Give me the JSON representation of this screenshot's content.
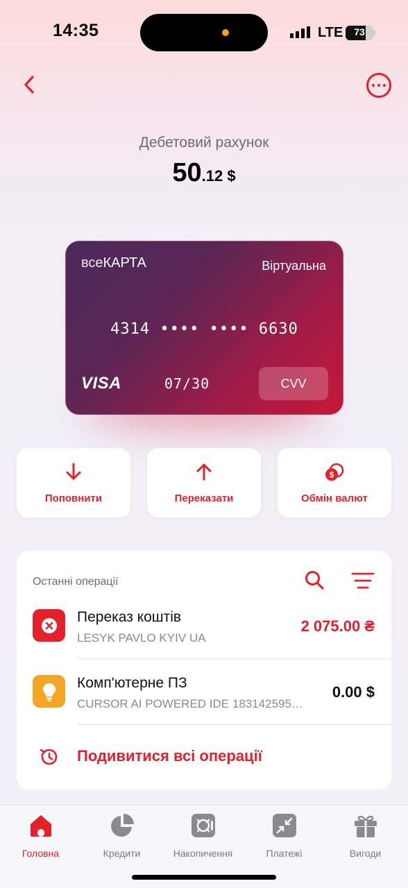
{
  "status_bar": {
    "time": "14:35",
    "network": "LTE",
    "battery": "73"
  },
  "header": {
    "back_icon": "chevron-left-icon",
    "more_icon": "more-dots-icon"
  },
  "account": {
    "title": "Дебетовий рахунок",
    "balance_int": "50",
    "balance_frac": ".12 $"
  },
  "card": {
    "brand_prefix": "все",
    "brand_name": "КАРТА",
    "type": "Віртуальна",
    "number": "4314 •••• •••• 6630",
    "network": "VISA",
    "expiry": "07/30",
    "cvv_label": "CVV"
  },
  "actions": [
    {
      "label": "Поповнити",
      "icon": "arrow-down-icon"
    },
    {
      "label": "Переказати",
      "icon": "arrow-up-icon"
    },
    {
      "label": "Обмін валют",
      "icon": "currency-exchange-icon"
    }
  ],
  "operations": {
    "title": "Останні операції",
    "items": [
      {
        "name": "Переказ коштів",
        "description": "LESYK PAVLO KYIV UA",
        "amount": "2 075.00 ₴",
        "amount_color": "#e4202a",
        "icon": "cancel-x-icon",
        "icon_bg": "#e4202a"
      },
      {
        "name": "Комп'ютерне ПЗ",
        "description": "CURSOR AI POWERED IDE 183142595…",
        "amount": "0.00 $",
        "amount_color": "#111111",
        "icon": "lightbulb-icon",
        "icon_bg": "#f5a524"
      }
    ],
    "view_all": "Подивитися всі операції"
  },
  "nav": [
    {
      "label": "Головна",
      "icon": "home-icon",
      "active": true
    },
    {
      "label": "Кредити",
      "icon": "pie-chart-icon",
      "active": false
    },
    {
      "label": "Накопичення",
      "icon": "safe-icon",
      "active": false
    },
    {
      "label": "Платежі",
      "icon": "transfer-icon",
      "active": false
    },
    {
      "label": "Вигоди",
      "icon": "gift-icon",
      "active": false
    }
  ],
  "colors": {
    "accent": "#e4202a",
    "card_start": "#4b2a5b",
    "card_end": "#c61737"
  }
}
